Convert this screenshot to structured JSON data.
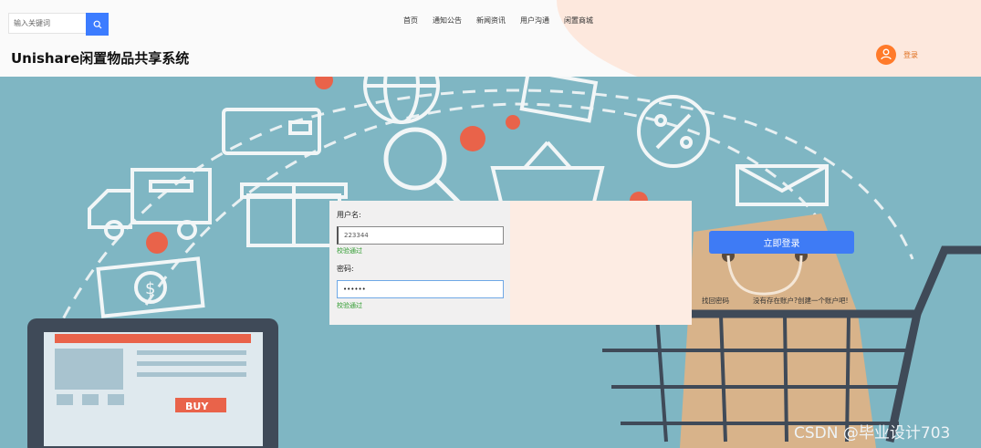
{
  "search": {
    "placeholder": "输入关键词",
    "icon": "search-icon"
  },
  "nav": {
    "items": [
      "首页",
      "通知公告",
      "新闻资讯",
      "用户沟通",
      "闲置商城"
    ]
  },
  "site": {
    "title": "Unishare闲置物品共享系统"
  },
  "user": {
    "login_label": "登录",
    "icon": "user-icon"
  },
  "login_form": {
    "username_label": "用户名:",
    "username_value": "223344",
    "username_validation": "校验通过",
    "password_label": "密码:",
    "password_value": "••••••",
    "password_validation": "校验通过",
    "submit_label": "立即登录",
    "forgot_label": "找回密码",
    "register_label": "没有存在账户?创建一个账户吧!"
  },
  "hero": {
    "badge_text": "BUY"
  },
  "watermark": "CSDN @毕业设计703",
  "colors": {
    "accent": "#3e7bf5",
    "hero_bg": "#7fb6c3",
    "avatar": "#ff7a2a",
    "valid": "#2e9b2e"
  }
}
